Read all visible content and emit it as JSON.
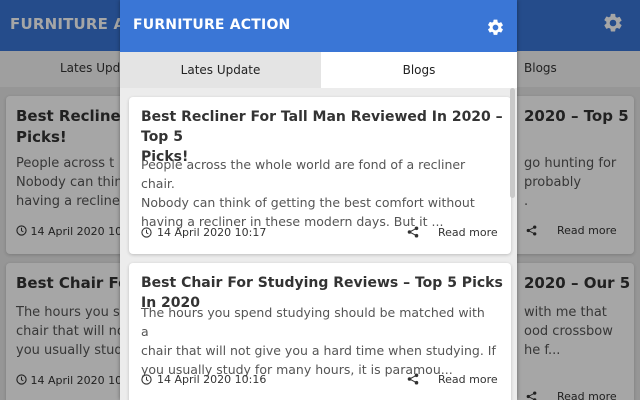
{
  "app": {
    "title": "FURNITURE ACTION",
    "bg_title": "FURNITURE ACTI"
  },
  "tabs": [
    {
      "label": "Lates Update",
      "active": true
    },
    {
      "label": "Blogs",
      "active": false
    }
  ],
  "bg_tabs": {
    "left": "Lates Upda",
    "right": "Blogs"
  },
  "posts": [
    {
      "title_lines": [
        "Best Recliner For Tall Man Reviewed In 2020 – Top 5",
        "Picks!"
      ],
      "excerpt_lines": [
        "People across the whole world are fond of a recliner chair.",
        "Nobody can think of getting the best comfort without",
        "having a recliner in these modern days. But it ..."
      ],
      "date": "14 April 2020 10:17",
      "read_more": "Read more"
    },
    {
      "title_lines": [
        "Best Chair For Studying Reviews – Top 5 Picks In 2020"
      ],
      "excerpt_lines": [
        "The hours you spend studying should be matched with a",
        "chair that will not give you a hard time when studying. If",
        "you usually study for many hours, it is paramou..."
      ],
      "date": "14 April 2020 10:16",
      "read_more": "Read more"
    }
  ],
  "bg_left_cards": [
    {
      "title_lines": [
        "Best Recliner F",
        "Picks!"
      ],
      "excerpt_lines": [
        "People across t",
        "Nobody can think",
        "having a recliner"
      ],
      "date": "14 April 2020 10"
    },
    {
      "title_lines": [
        "Best Chair For S"
      ],
      "excerpt_lines": [
        "The hours you sp",
        "chair that will no",
        "you usually study"
      ],
      "date": "14 April 2020 10"
    }
  ],
  "bg_right_cards": [
    {
      "title": "2020 – Top 5",
      "excerpt_lines": [
        "go hunting for",
        "probably",
        "."
      ],
      "read_more": "Read more"
    },
    {
      "title": "2020 – Our 5",
      "excerpt_lines": [
        "with me that",
        "ood crossbow",
        "he f..."
      ],
      "read_more": "Read more"
    }
  ],
  "colors": {
    "header": "#3a76d6",
    "tab_active": "#e4e4e4",
    "tab_inactive": "#ffffff",
    "panel_bg": "#ececec"
  },
  "icons": {
    "settings": "gear-icon",
    "time": "clock-icon",
    "share": "share-icon"
  }
}
